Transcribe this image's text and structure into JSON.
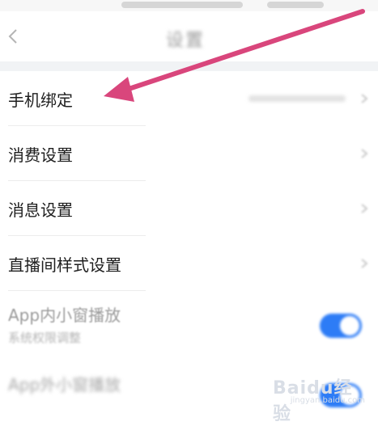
{
  "nav": {
    "title": "设置"
  },
  "settings": {
    "items": [
      {
        "label": "手机绑定"
      },
      {
        "label": "消费设置"
      },
      {
        "label": "消息设置"
      },
      {
        "label": "直播间样式设置"
      }
    ],
    "app_window": {
      "label": "App内小窗播放",
      "sublabel": "系统权限调整",
      "enabled": true
    },
    "app_next": {
      "label": "App外小窗播放",
      "enabled": true
    }
  },
  "watermark": {
    "brand": "Baidu经验",
    "url": "jingyan.baidu.com"
  },
  "colors": {
    "annotation_arrow": "#d9467c",
    "toggle_on": "#2d7cf6",
    "section_gap": "#f1f3f5"
  }
}
